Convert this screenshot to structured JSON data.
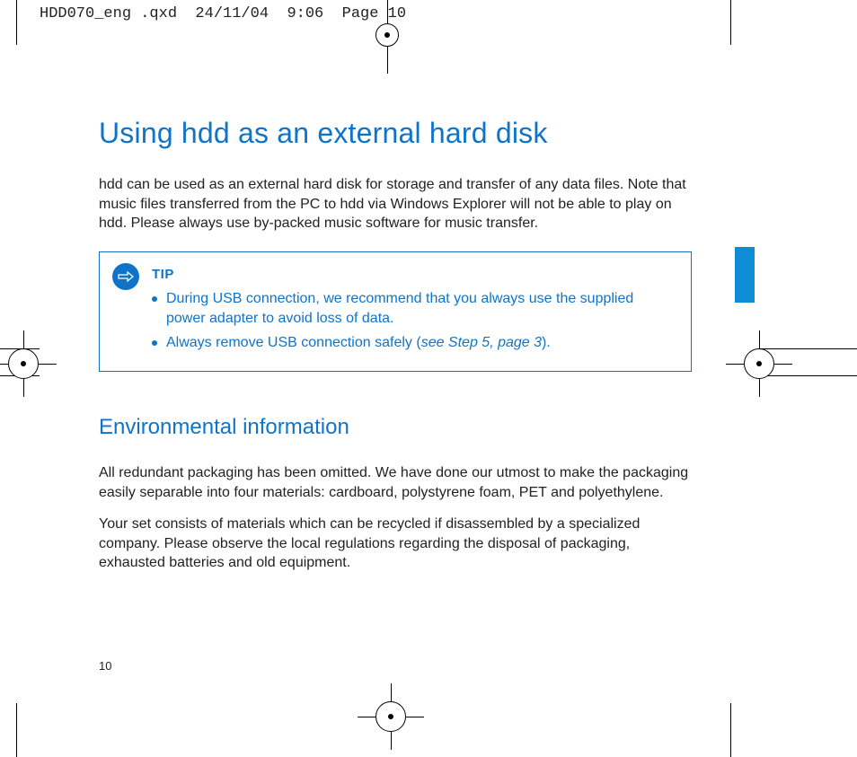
{
  "meta_header": "HDD070_eng .qxd  24/11/04  9:06  Page 10",
  "page_number": "10",
  "colors": {
    "brand_blue": "#0f74c8",
    "tab_blue": "#0f8cd6"
  },
  "sections": {
    "usb": {
      "title": "Using hdd as an external hard disk",
      "para1": "hdd can be used as an external hard disk for storage and transfer of any data files. Note that music files transferred from the PC to hdd via Windows Explorer will not be able to play on hdd. Please always use by-packed music software for music transfer."
    },
    "env": {
      "title": "Environmental information",
      "para1": "All redundant packaging has been omitted. We have done our utmost to make the packaging easily separable into four materials: cardboard, polystyrene foam, PET and polyethylene.",
      "para2": "Your set consists of materials which can be recycled if disassembled by a specialized company. Please observe the local regulations regarding the disposal of packaging, exhausted batteries and old equipment."
    }
  },
  "tip": {
    "label": "TIP",
    "items": [
      "During USB connection, we recommend that you always use the supplied power adapter to avoid loss of data.",
      "Always remove USB connection safely"
    ],
    "reference_prefix": " (",
    "reference": "see Step 5, page 3",
    "reference_suffix": ")."
  }
}
